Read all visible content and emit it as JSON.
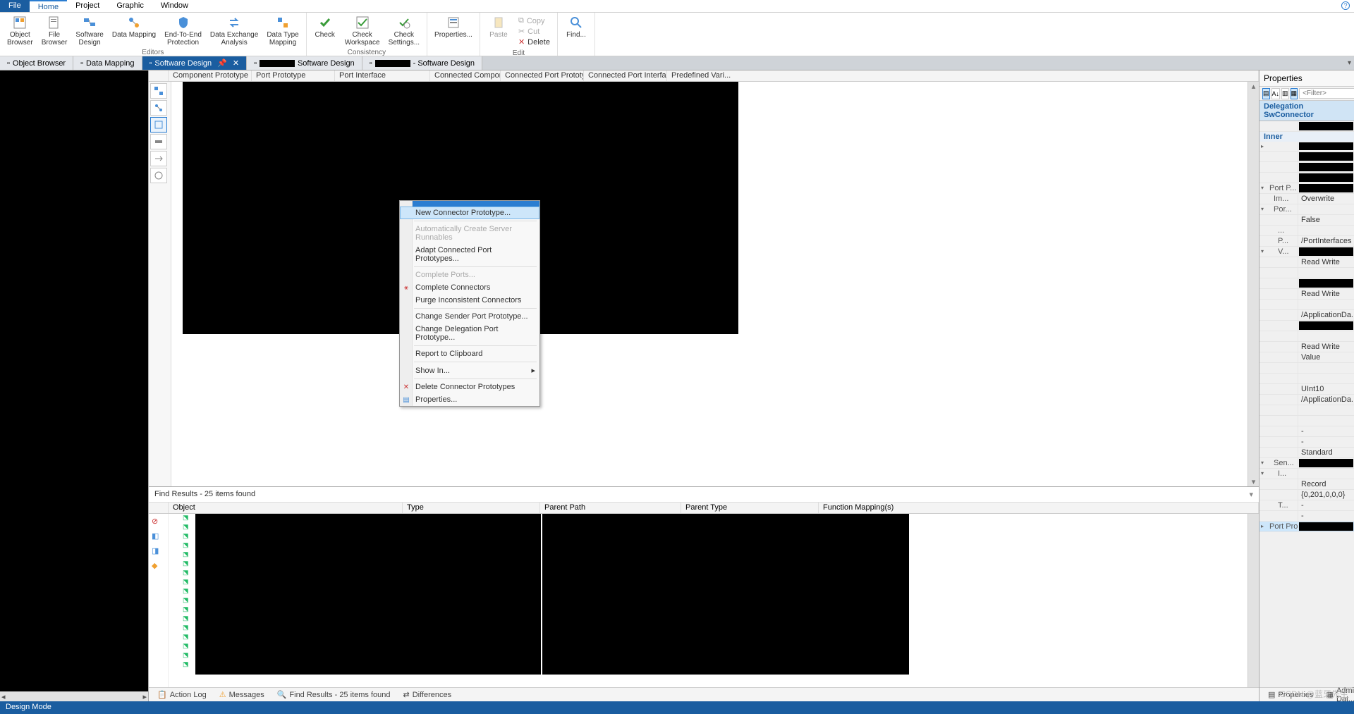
{
  "menu": {
    "file": "File",
    "home": "Home",
    "project": "Project",
    "graphic": "Graphic",
    "window": "Window"
  },
  "ribbon": {
    "editors": {
      "label": "Editors",
      "object_browser": "Object\nBrowser",
      "file_browser": "File\nBrowser",
      "software_design": "Software\nDesign",
      "data_mapping": "Data Mapping",
      "end_to_end": "End-To-End\nProtection",
      "data_exchange": "Data Exchange\nAnalysis",
      "data_type_mapping": "Data Type\nMapping"
    },
    "consistency": {
      "label": "Consistency",
      "check": "Check",
      "check_workspace": "Check\nWorkspace",
      "check_settings": "Check\nSettings..."
    },
    "properties": "Properties...",
    "edit": {
      "label": "Edit",
      "paste": "Paste",
      "copy": "Copy",
      "cut": "Cut",
      "delete": "Delete"
    },
    "find": "Find..."
  },
  "doctabs": {
    "t1": "Object Browser",
    "t2": "Data Mapping",
    "t3": "Software Design",
    "t4_suffix": "Software Design",
    "t5_suffix": "- Software Design"
  },
  "columns": {
    "c1": "Component Prototype",
    "c2": "Port Prototype",
    "c3": "Port Interface",
    "c4": "Connected Component Pro...",
    "c5": "Connected Port Prototype",
    "c6": "Connected Port Interface",
    "c7": "Predefined Vari..."
  },
  "context_menu": {
    "new_connector": "New Connector Prototype...",
    "auto_runnables": "Automatically Create Server Runnables",
    "adapt_connected": "Adapt Connected Port Prototypes...",
    "complete_ports": "Complete Ports...",
    "complete_connectors": "Complete Connectors",
    "purge": "Purge Inconsistent Connectors",
    "change_sender": "Change Sender Port Prototype...",
    "change_delegation": "Change Delegation Port Prototype...",
    "report_clipboard": "Report to Clipboard",
    "show_in": "Show In...",
    "delete_connector": "Delete Connector Prototypes",
    "properties": "Properties..."
  },
  "find": {
    "title": "Find Results - 25 items found",
    "cols": {
      "object": "Object",
      "type": "Type",
      "parent_path": "Parent Path",
      "parent_type": "Parent Type",
      "fn_mapping": "Function Mapping(s)"
    }
  },
  "props": {
    "title": "Properties",
    "filter_placeholder": "<Filter>",
    "header": "Delegation SwConnector",
    "section_inner": "Inner",
    "rows": {
      "port_p": "Port P...",
      "im": "Im...",
      "im_v": "Overwrite",
      "por": "Por...",
      "false": "False",
      "dots": "...",
      "p": "P...",
      "p_v": "/PortInterfaces",
      "v": "V...",
      "rw": "Read Write",
      "rw2": "Read Write",
      "appdata": "/ApplicationDa...",
      "rw3": "Read Write",
      "value": "Value",
      "uint10": "UInt10",
      "appdata2": "/ApplicationDa...",
      "dash": "-",
      "standard": "Standard",
      "sen": "Sen...",
      "i": "I...",
      "record": "Record",
      "coords": "{0,201,0,0,0}",
      "t": "T...",
      "port_pro": "Port Pro..."
    }
  },
  "bottom_tabs": {
    "action_log": "Action Log",
    "messages": "Messages",
    "find_results": "Find Results - 25 items found",
    "differences": "Differences",
    "properties": "Properties",
    "admin_dat": "Admin Dat..."
  },
  "status": "Design Mode",
  "watermark": "CSDN @蓝牙先生"
}
